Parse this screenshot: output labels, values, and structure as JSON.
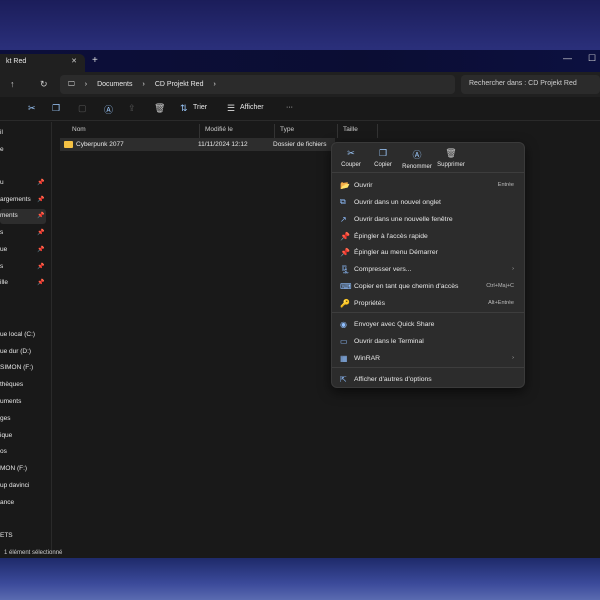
{
  "window": {
    "tab_title": "kt Red",
    "close": "✕",
    "new_tab": "+",
    "minimize": "—",
    "maximize": "☐"
  },
  "address": {
    "breadcrumb": [
      "Documents",
      "CD Projekt Red"
    ],
    "search_placeholder": "Rechercher dans : CD Projekt Red"
  },
  "toolbar": {
    "sort": "Trier",
    "view": "Afficher",
    "more": "···"
  },
  "sidebar": {
    "items": [
      {
        "label": "il",
        "pinned": false
      },
      {
        "label": "e",
        "pinned": false
      },
      {
        "label": "u",
        "pinned": true
      },
      {
        "label": "argements",
        "pinned": true
      },
      {
        "label": "ments",
        "pinned": true,
        "selected": true
      },
      {
        "label": "s",
        "pinned": true
      },
      {
        "label": "ue",
        "pinned": true
      },
      {
        "label": "s",
        "pinned": true
      },
      {
        "label": "ille",
        "pinned": true
      },
      {
        "label": "ue local (C:)"
      },
      {
        "label": "ue dur (D:)"
      },
      {
        "label": "SIMON (F:)"
      },
      {
        "label": "thèques"
      },
      {
        "label": "uments"
      },
      {
        "label": "ges"
      },
      {
        "label": "ique"
      },
      {
        "label": "os"
      },
      {
        "label": "MON (F:)"
      },
      {
        "label": "up davinci"
      },
      {
        "label": "ance"
      },
      {
        "label": "ETS"
      }
    ]
  },
  "columns": [
    "Nom",
    "Modifié le",
    "Type",
    "Taille"
  ],
  "files": [
    {
      "name": "Cyberpunk 2077",
      "modified": "11/11/2024 12:12",
      "type": "Dossier de fichiers",
      "size": ""
    }
  ],
  "status": "1 élément sélectionné",
  "context_menu": {
    "quick_actions": [
      "Couper",
      "Copier",
      "Renommer",
      "Supprimer"
    ],
    "items": [
      {
        "label": "Ouvrir",
        "shortcut": "Entrée"
      },
      {
        "label": "Ouvrir dans un nouvel onglet",
        "shortcut": ""
      },
      {
        "label": "Ouvrir dans une nouvelle fenêtre",
        "shortcut": ""
      },
      {
        "label": "Épingler à l'accès rapide",
        "shortcut": ""
      },
      {
        "label": "Épingler au menu Démarrer",
        "shortcut": ""
      },
      {
        "label": "Compresser vers...",
        "shortcut": "›"
      },
      {
        "label": "Copier en tant que chemin d'accès",
        "shortcut": "Ctrl+Maj+C"
      },
      {
        "label": "Propriétés",
        "shortcut": "Alt+Entrée"
      },
      {
        "label": "Envoyer avec Quick Share",
        "shortcut": ""
      },
      {
        "label": "Ouvrir dans le Terminal",
        "shortcut": ""
      },
      {
        "label": "WinRAR",
        "shortcut": "›"
      },
      {
        "label": "Afficher d'autres d'options",
        "shortcut": ""
      }
    ]
  }
}
